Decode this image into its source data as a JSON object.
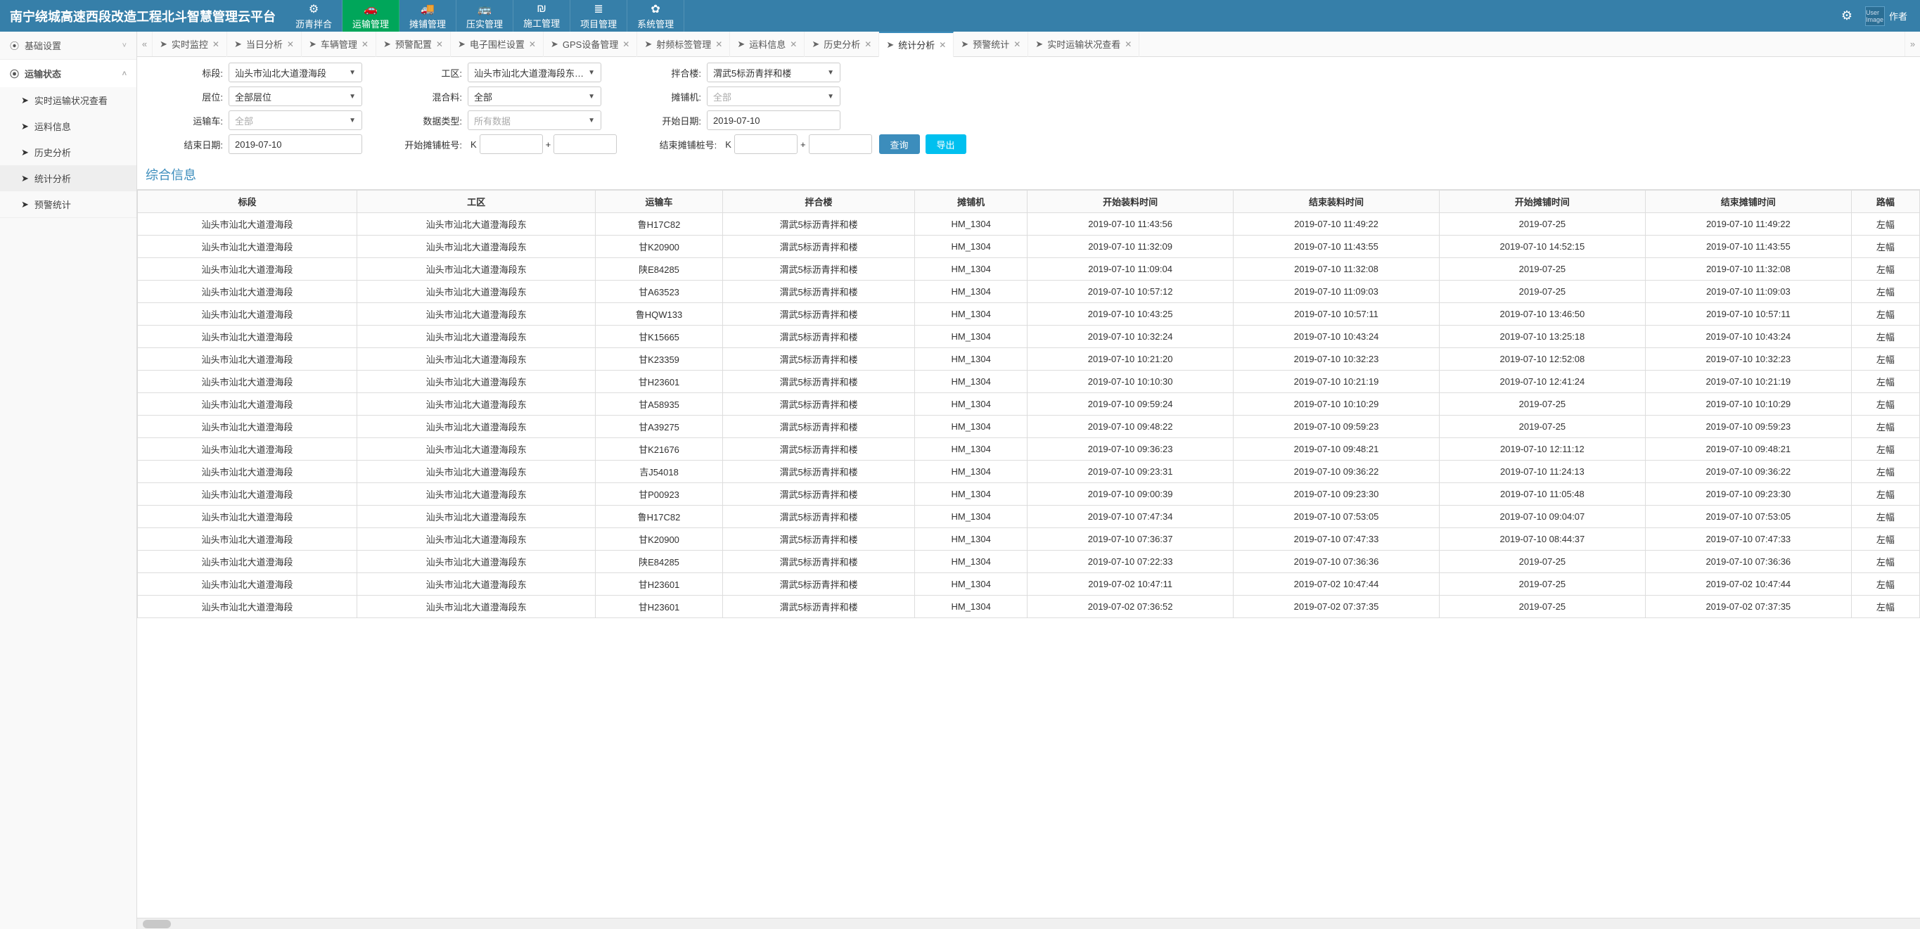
{
  "brand": "南宁绕城高速西段改造工程北斗智慧管理云平台",
  "topnav": [
    {
      "label": "沥青拌合",
      "icon": "⚙"
    },
    {
      "label": "运输管理",
      "icon": "🚗",
      "active": true
    },
    {
      "label": "摊铺管理",
      "icon": "🚚"
    },
    {
      "label": "压实管理",
      "icon": "🚌"
    },
    {
      "label": "施工管理",
      "icon": "₪"
    },
    {
      "label": "项目管理",
      "icon": "≣"
    },
    {
      "label": "系统管理",
      "icon": "✿"
    }
  ],
  "user_label": "作者",
  "avatar_alt": "User Image",
  "sidebar": {
    "groups": [
      {
        "label": "基础设置",
        "expanded": false
      },
      {
        "label": "运输状态",
        "expanded": true,
        "items": [
          {
            "label": "实时运输状况查看"
          },
          {
            "label": "运料信息"
          },
          {
            "label": "历史分析"
          },
          {
            "label": "统计分析",
            "active": true
          },
          {
            "label": "预警统计"
          }
        ]
      }
    ]
  },
  "tabs": [
    {
      "label": "实时监控"
    },
    {
      "label": "当日分析"
    },
    {
      "label": "车辆管理"
    },
    {
      "label": "预警配置"
    },
    {
      "label": "电子围栏设置"
    },
    {
      "label": "GPS设备管理"
    },
    {
      "label": "射频标签管理"
    },
    {
      "label": "运料信息"
    },
    {
      "label": "历史分析"
    },
    {
      "label": "统计分析",
      "active": true
    },
    {
      "label": "预警统计"
    },
    {
      "label": "实时运输状况查看"
    }
  ],
  "filters": {
    "row1": [
      {
        "label": "标段:",
        "value": "汕头市汕北大道澄海段",
        "type": "select"
      },
      {
        "label": "工区:",
        "value": "汕头市汕北大道澄海段东里区",
        "type": "select"
      },
      {
        "label": "拌合楼:",
        "value": "渭武5标沥青拌和楼",
        "type": "select"
      }
    ],
    "row2": [
      {
        "label": "层位:",
        "value": "全部层位",
        "type": "select"
      },
      {
        "label": "混合料:",
        "value": "全部",
        "type": "select"
      },
      {
        "label": "摊铺机:",
        "value": "全部",
        "type": "select",
        "placeholder": true
      }
    ],
    "row3": [
      {
        "label": "运输车:",
        "value": "全部",
        "type": "select",
        "placeholder": true
      },
      {
        "label": "数据类型:",
        "value": "所有数据",
        "type": "select",
        "placeholder": true
      },
      {
        "label": "开始日期:",
        "value": "2019-07-10",
        "type": "date"
      }
    ],
    "row4_end_date_label": "结束日期:",
    "row4_end_date_value": "2019-07-10",
    "row4_start_pile_label": "开始摊铺桩号:",
    "row4_end_pile_label": "结束摊铺桩号:",
    "k_prefix": "K",
    "plus": "+",
    "query_btn": "查询",
    "export_btn": "导出"
  },
  "section_title": "综合信息",
  "columns": [
    "标段",
    "工区",
    "运输车",
    "拌合楼",
    "摊铺机",
    "开始装料时间",
    "结束装料时间",
    "开始摊铺时间",
    "结束摊铺时间",
    "路幅"
  ],
  "rows": [
    [
      "汕头市汕北大道澄海段",
      "汕头市汕北大道澄海段东",
      "鲁H17C82",
      "渭武5标沥青拌和楼",
      "HM_1304",
      "2019-07-10 11:43:56",
      "2019-07-10 11:49:22",
      "2019-07-25",
      "2019-07-10 11:49:22",
      "左幅"
    ],
    [
      "汕头市汕北大道澄海段",
      "汕头市汕北大道澄海段东",
      "甘K20900",
      "渭武5标沥青拌和楼",
      "HM_1304",
      "2019-07-10 11:32:09",
      "2019-07-10 11:43:55",
      "2019-07-10 14:52:15",
      "2019-07-10 11:43:55",
      "左幅"
    ],
    [
      "汕头市汕北大道澄海段",
      "汕头市汕北大道澄海段东",
      "陕E84285",
      "渭武5标沥青拌和楼",
      "HM_1304",
      "2019-07-10 11:09:04",
      "2019-07-10 11:32:08",
      "2019-07-25",
      "2019-07-10 11:32:08",
      "左幅"
    ],
    [
      "汕头市汕北大道澄海段",
      "汕头市汕北大道澄海段东",
      "甘A63523",
      "渭武5标沥青拌和楼",
      "HM_1304",
      "2019-07-10 10:57:12",
      "2019-07-10 11:09:03",
      "2019-07-25",
      "2019-07-10 11:09:03",
      "左幅"
    ],
    [
      "汕头市汕北大道澄海段",
      "汕头市汕北大道澄海段东",
      "鲁HQW133",
      "渭武5标沥青拌和楼",
      "HM_1304",
      "2019-07-10 10:43:25",
      "2019-07-10 10:57:11",
      "2019-07-10 13:46:50",
      "2019-07-10 10:57:11",
      "左幅"
    ],
    [
      "汕头市汕北大道澄海段",
      "汕头市汕北大道澄海段东",
      "甘K15665",
      "渭武5标沥青拌和楼",
      "HM_1304",
      "2019-07-10 10:32:24",
      "2019-07-10 10:43:24",
      "2019-07-10 13:25:18",
      "2019-07-10 10:43:24",
      "左幅"
    ],
    [
      "汕头市汕北大道澄海段",
      "汕头市汕北大道澄海段东",
      "甘K23359",
      "渭武5标沥青拌和楼",
      "HM_1304",
      "2019-07-10 10:21:20",
      "2019-07-10 10:32:23",
      "2019-07-10 12:52:08",
      "2019-07-10 10:32:23",
      "左幅"
    ],
    [
      "汕头市汕北大道澄海段",
      "汕头市汕北大道澄海段东",
      "甘H23601",
      "渭武5标沥青拌和楼",
      "HM_1304",
      "2019-07-10 10:10:30",
      "2019-07-10 10:21:19",
      "2019-07-10 12:41:24",
      "2019-07-10 10:21:19",
      "左幅"
    ],
    [
      "汕头市汕北大道澄海段",
      "汕头市汕北大道澄海段东",
      "甘A58935",
      "渭武5标沥青拌和楼",
      "HM_1304",
      "2019-07-10 09:59:24",
      "2019-07-10 10:10:29",
      "2019-07-25",
      "2019-07-10 10:10:29",
      "左幅"
    ],
    [
      "汕头市汕北大道澄海段",
      "汕头市汕北大道澄海段东",
      "甘A39275",
      "渭武5标沥青拌和楼",
      "HM_1304",
      "2019-07-10 09:48:22",
      "2019-07-10 09:59:23",
      "2019-07-25",
      "2019-07-10 09:59:23",
      "左幅"
    ],
    [
      "汕头市汕北大道澄海段",
      "汕头市汕北大道澄海段东",
      "甘K21676",
      "渭武5标沥青拌和楼",
      "HM_1304",
      "2019-07-10 09:36:23",
      "2019-07-10 09:48:21",
      "2019-07-10 12:11:12",
      "2019-07-10 09:48:21",
      "左幅"
    ],
    [
      "汕头市汕北大道澄海段",
      "汕头市汕北大道澄海段东",
      "吉J54018",
      "渭武5标沥青拌和楼",
      "HM_1304",
      "2019-07-10 09:23:31",
      "2019-07-10 09:36:22",
      "2019-07-10 11:24:13",
      "2019-07-10 09:36:22",
      "左幅"
    ],
    [
      "汕头市汕北大道澄海段",
      "汕头市汕北大道澄海段东",
      "甘P00923",
      "渭武5标沥青拌和楼",
      "HM_1304",
      "2019-07-10 09:00:39",
      "2019-07-10 09:23:30",
      "2019-07-10 11:05:48",
      "2019-07-10 09:23:30",
      "左幅"
    ],
    [
      "汕头市汕北大道澄海段",
      "汕头市汕北大道澄海段东",
      "鲁H17C82",
      "渭武5标沥青拌和楼",
      "HM_1304",
      "2019-07-10 07:47:34",
      "2019-07-10 07:53:05",
      "2019-07-10 09:04:07",
      "2019-07-10 07:53:05",
      "左幅"
    ],
    [
      "汕头市汕北大道澄海段",
      "汕头市汕北大道澄海段东",
      "甘K20900",
      "渭武5标沥青拌和楼",
      "HM_1304",
      "2019-07-10 07:36:37",
      "2019-07-10 07:47:33",
      "2019-07-10 08:44:37",
      "2019-07-10 07:47:33",
      "左幅"
    ],
    [
      "汕头市汕北大道澄海段",
      "汕头市汕北大道澄海段东",
      "陕E84285",
      "渭武5标沥青拌和楼",
      "HM_1304",
      "2019-07-10 07:22:33",
      "2019-07-10 07:36:36",
      "2019-07-25",
      "2019-07-10 07:36:36",
      "左幅"
    ],
    [
      "汕头市汕北大道澄海段",
      "汕头市汕北大道澄海段东",
      "甘H23601",
      "渭武5标沥青拌和楼",
      "HM_1304",
      "2019-07-02 10:47:11",
      "2019-07-02 10:47:44",
      "2019-07-25",
      "2019-07-02 10:47:44",
      "左幅"
    ],
    [
      "汕头市汕北大道澄海段",
      "汕头市汕北大道澄海段东",
      "甘H23601",
      "渭武5标沥青拌和楼",
      "HM_1304",
      "2019-07-02 07:36:52",
      "2019-07-02 07:37:35",
      "2019-07-25",
      "2019-07-02 07:37:35",
      "左幅"
    ]
  ]
}
